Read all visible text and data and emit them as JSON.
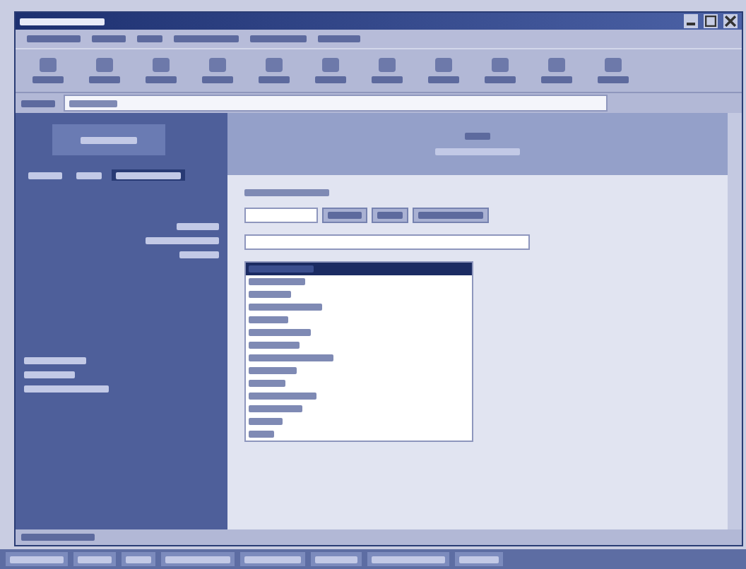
{
  "title_bar": {
    "texts": [
      {
        "kind": "illegible"
      }
    ],
    "buttons": [
      {
        "kind": "minimize"
      },
      {
        "kind": "maximize"
      },
      {
        "kind": "close"
      }
    ]
  },
  "menu_bar": {
    "items": [
      {
        "kind": "illegible"
      },
      {
        "kind": "illegible"
      },
      {
        "kind": "illegible"
      },
      {
        "kind": "illegible"
      },
      {
        "kind": "illegible"
      },
      {
        "kind": "illegible"
      }
    ]
  },
  "toolbar": {
    "buttons": [
      {
        "kind": "illegible"
      },
      {
        "kind": "illegible"
      },
      {
        "kind": "illegible"
      },
      {
        "kind": "illegible"
      },
      {
        "kind": "illegible"
      },
      {
        "kind": "illegible"
      },
      {
        "kind": "illegible"
      },
      {
        "kind": "illegible"
      },
      {
        "kind": "illegible"
      },
      {
        "kind": "illegible"
      },
      {
        "kind": "illegible"
      }
    ]
  },
  "address_bar": {
    "kind": "illegible"
  },
  "sidebar": {
    "logo": {
      "kind": "illegible"
    },
    "nav": [
      {
        "kind": "illegible",
        "selected": false
      },
      {
        "kind": "illegible",
        "selected": false
      },
      {
        "kind": "illegible",
        "selected": true
      }
    ],
    "blocks": [
      {
        "kind": "illegible"
      },
      {
        "kind": "illegible"
      }
    ]
  },
  "header": {
    "kind": "illegible"
  },
  "form": {
    "heading": {
      "kind": "illegible"
    },
    "buttons": [
      {
        "kind": "illegible"
      },
      {
        "kind": "illegible"
      },
      {
        "kind": "illegible"
      }
    ]
  },
  "listbox": {
    "items": [
      {
        "kind": "illegible",
        "selected": true
      },
      {
        "kind": "illegible",
        "selected": false
      },
      {
        "kind": "illegible",
        "selected": false
      },
      {
        "kind": "illegible",
        "selected": false
      },
      {
        "kind": "illegible",
        "selected": false
      },
      {
        "kind": "illegible",
        "selected": false
      },
      {
        "kind": "illegible",
        "selected": false
      },
      {
        "kind": "illegible",
        "selected": false
      },
      {
        "kind": "illegible",
        "selected": false
      },
      {
        "kind": "illegible",
        "selected": false
      },
      {
        "kind": "illegible",
        "selected": false
      },
      {
        "kind": "illegible",
        "selected": false
      },
      {
        "kind": "illegible",
        "selected": false
      },
      {
        "kind": "illegible",
        "selected": false
      }
    ]
  },
  "status_bar": {
    "kind": "illegible"
  },
  "taskbar": {
    "items": [
      {
        "kind": "illegible"
      },
      {
        "kind": "illegible"
      },
      {
        "kind": "illegible"
      },
      {
        "kind": "illegible"
      },
      {
        "kind": "illegible"
      },
      {
        "kind": "illegible"
      },
      {
        "kind": "illegible"
      },
      {
        "kind": "illegible"
      }
    ]
  }
}
